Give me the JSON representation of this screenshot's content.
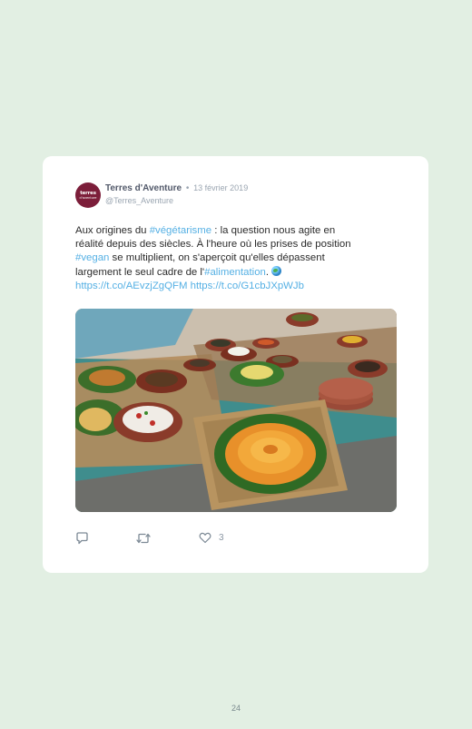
{
  "tweet": {
    "avatar": {
      "line1": "terres",
      "line2": "d'aventure"
    },
    "author_name": "Terres d'Aventure",
    "separator": "•",
    "date": "13 février 2019",
    "handle": "@Terres_Aventure",
    "text": {
      "l1_a": "Aux origines du ",
      "l1_link": "#végétarisme",
      "l1_b": " : la question nous agite en",
      "l2": "réalité depuis des siècles. À l'heure où les prises de position",
      "l3_link": "#vegan",
      "l3_b": " se multiplient, on s'aperçoit qu'elles dépassent",
      "l4_a": "largement le seul cadre de l'",
      "l4_link": "#alimentation",
      "l4_b": ".",
      "l5_link1": "https://t.co/AEvzjZgQFM",
      "l5_link2": "https://t.co/G1cbJXpWJb"
    },
    "globe_icon": "globe-emoji-icon",
    "image_desc_icon": "tweet-photo",
    "actions": {
      "reply_icon": "reply-icon",
      "retweet_icon": "retweet-icon",
      "like_icon": "heart-icon",
      "like_count": "3"
    }
  },
  "page": {
    "number": "24"
  },
  "colors": {
    "background": "#e2efe3",
    "card": "#ffffff",
    "link": "#55b0e4",
    "brand": "#7c1e3a"
  }
}
